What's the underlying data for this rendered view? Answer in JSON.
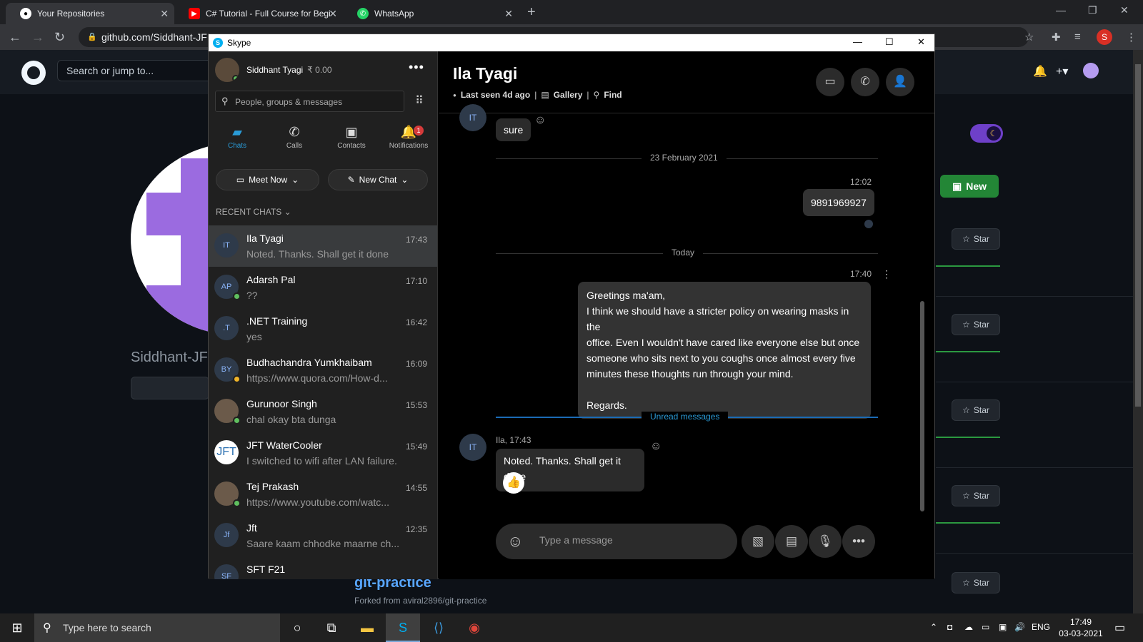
{
  "browser": {
    "tabs": [
      {
        "title": "Your Repositories",
        "favicon": "github-icon"
      },
      {
        "title": "C# Tutorial - Full Course for Begi",
        "favicon": "youtube-icon"
      },
      {
        "title": "WhatsApp",
        "favicon": "whatsapp-icon"
      }
    ],
    "url": "github.com/Siddhant-JF",
    "profile_initial": "S"
  },
  "github": {
    "search_placeholder": "Search or jump to...",
    "username": "Siddhant-JFT",
    "new_button": "New",
    "star_label": "Star",
    "repo_name": "git-practice",
    "repo_fork": "Forked from aviral2896/git-practice"
  },
  "skype": {
    "window_title": "Skype",
    "profile": {
      "name": "Siddhant Tyagi",
      "credit": "₹ 0.00"
    },
    "search_placeholder": "People, groups & messages",
    "nav": [
      {
        "label": "Chats",
        "icon": "chat-icon"
      },
      {
        "label": "Calls",
        "icon": "phone-icon"
      },
      {
        "label": "Contacts",
        "icon": "contacts-icon"
      },
      {
        "label": "Notifications",
        "icon": "bell-icon",
        "badge": "1"
      }
    ],
    "meet_now": "Meet Now",
    "new_chat": "New Chat",
    "recent_label": "RECENT CHATS",
    "chats": [
      {
        "initials": "IT",
        "name": "Ila Tyagi",
        "preview": "Noted. Thanks. Shall get it done",
        "time": "17:43",
        "selected": true,
        "status": ""
      },
      {
        "initials": "AP",
        "name": "Adarsh Pal",
        "preview": "??",
        "time": "17:10",
        "status": "#5fbf5f"
      },
      {
        "initials": ".T",
        "name": ".NET Training",
        "preview": "yes",
        "time": "16:42",
        "status": ""
      },
      {
        "initials": "BY",
        "name": "Budhachandra Yumkhaibam",
        "preview": "https://www.quora.com/How-d...",
        "time": "16:09",
        "status": "#f0b429"
      },
      {
        "initials": "GS",
        "name": "Gurunoor Singh",
        "preview": "chal okay bta dunga",
        "time": "15:53",
        "status": "#5fbf5f",
        "photo": true
      },
      {
        "initials": "JFT",
        "name": "JFT WaterCooler",
        "preview": "I switched to wifi after LAN failure.",
        "time": "15:49",
        "status": "",
        "jft": true
      },
      {
        "initials": "TP",
        "name": "Tej Prakash",
        "preview": "https://www.youtube.com/watc...",
        "time": "14:55",
        "status": "#5fbf5f",
        "photo": true
      },
      {
        "initials": "Jf",
        "name": "Jft",
        "preview": "Saare kaam chhodke maarne ch...",
        "time": "12:35",
        "status": ""
      },
      {
        "initials": "SF",
        "name": "SFT F21",
        "preview": "",
        "time": "",
        "status": ""
      }
    ],
    "conversation": {
      "name": "Ila Tyagi",
      "last_seen": "Last seen 4d ago",
      "gallery": "Gallery",
      "find": "Find",
      "messages": {
        "sure": "sure",
        "date1": "23 February 2021",
        "time1": "12:02",
        "phone": "9891969927",
        "today": "Today",
        "time2": "17:40",
        "long_msg": [
          "Greetings ma'am,",
          "I think we should have a stricter policy on wearing masks in the",
          "office. Even I wouldn't have cared like everyone else but once",
          "someone who sits next to you coughs once almost every five",
          "minutes these thoughts run through your mind.",
          "",
          "Regards."
        ],
        "unread": "Unread messages",
        "sender_time": "Ila, 17:43",
        "reply": "Noted. Thanks. Shall get it done"
      },
      "compose_placeholder": "Type a message"
    }
  },
  "taskbar": {
    "search_placeholder": "Type here to search",
    "lang": "ENG",
    "time": "17:49",
    "date": "03-03-2021"
  }
}
